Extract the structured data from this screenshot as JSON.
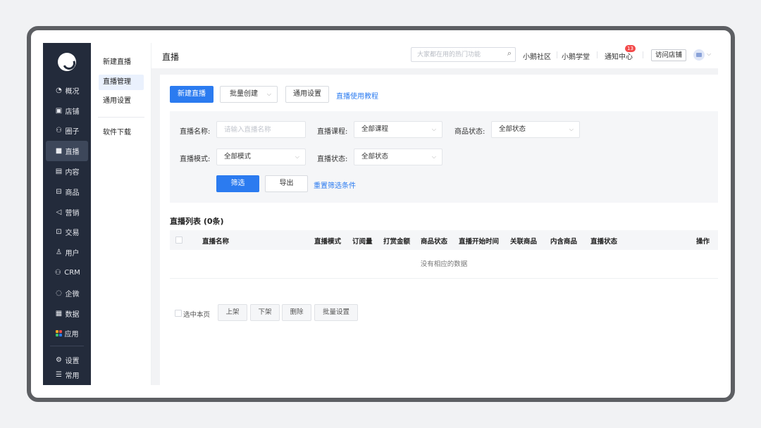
{
  "sidebar": {
    "items": [
      {
        "label": "概况",
        "icon": "◔"
      },
      {
        "label": "店铺",
        "icon": "▣"
      },
      {
        "label": "圈子",
        "icon": "⚇"
      },
      {
        "label": "直播",
        "icon": "■"
      },
      {
        "label": "内容",
        "icon": "▤"
      },
      {
        "label": "商品",
        "icon": "⊟"
      },
      {
        "label": "营销",
        "icon": "◁"
      },
      {
        "label": "交易",
        "icon": "⊡"
      },
      {
        "label": "用户",
        "icon": "♙"
      },
      {
        "label": "CRM",
        "icon": "⚇"
      },
      {
        "label": "企微",
        "icon": "◌"
      },
      {
        "label": "数据",
        "icon": "▦"
      },
      {
        "label": "应用",
        "icon": "apps"
      }
    ],
    "bottom": [
      {
        "label": "设置",
        "icon": "⚙"
      },
      {
        "label": "常用",
        "icon": "☰"
      }
    ],
    "apps_colors": [
      "#f5a623",
      "#e94c4c",
      "#3ac26f",
      "#2b7bf0"
    ]
  },
  "submenu": {
    "items": [
      "新建直播",
      "直播管理",
      "通用设置"
    ],
    "download": "软件下载"
  },
  "header": {
    "title": "直播",
    "search_placeholder": "大家都在用的热门功能",
    "community": "小鹅社区",
    "school": "小鹅学堂",
    "notify": "通知中心",
    "notify_count": "13",
    "visit_shop": "访问店铺"
  },
  "toolbar": {
    "new_live": "新建直播",
    "batch_create": "批量创建",
    "general_settings": "通用设置",
    "tutorial": "直播使用教程"
  },
  "filters": {
    "name_label": "直播名称:",
    "name_placeholder": "请输入直播名称",
    "course_label": "直播课程:",
    "course_value": "全部课程",
    "goods_label": "商品状态:",
    "goods_value": "全部状态",
    "mode_label": "直播模式:",
    "mode_value": "全部模式",
    "status_label": "直播状态:",
    "status_value": "全部状态",
    "filter_btn": "筛选",
    "export_btn": "导出",
    "reset": "重置筛选条件"
  },
  "list": {
    "title": "直播列表 (0条)",
    "columns": [
      "直播名称",
      "直播模式",
      "订阅量",
      "打赏金额",
      "商品状态",
      "直播开始时间",
      "关联商品",
      "内含商品",
      "直播状态",
      "操作"
    ],
    "empty": "没有相应的数据"
  },
  "bulk": {
    "select_page": "选中本页",
    "on_shelf": "上架",
    "off_shelf": "下架",
    "delete": "删除",
    "batch_settings": "批量设置"
  }
}
